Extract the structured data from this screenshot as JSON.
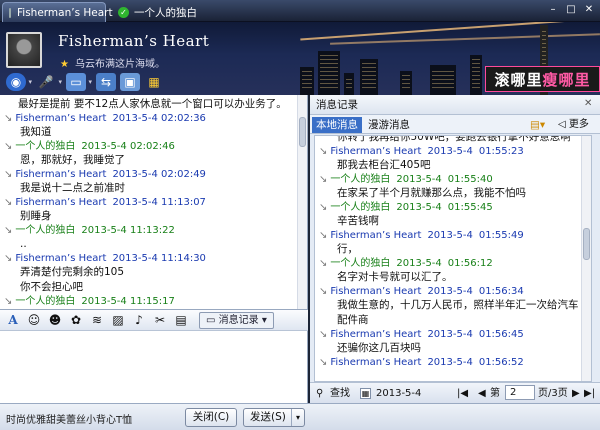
{
  "tabs": [
    {
      "label": "Fisherman’s Heart",
      "active": true
    },
    {
      "label": "一个人的独白",
      "active": false
    }
  ],
  "profile": {
    "name": "Fisherman’s Heart",
    "signature": "乌云布满这片海域。"
  },
  "banner": {
    "text_a": "滚哪里",
    "text_b": "瘦哪里"
  },
  "toolbar": {
    "icons": [
      "video-call-icon",
      "voice-call-icon",
      "file-transfer-icon",
      "remote-assist-icon",
      "screen-share-icon",
      "apps-grid-icon"
    ]
  },
  "chat": {
    "top_line": "最好是提前  要不12点人家休息就一个窗口可以办业务了。",
    "messages": [
      {
        "sender": "Fisherman’s Heart",
        "time": "2013-5-4 02:02:36",
        "side": "me",
        "lines": [
          "我知道"
        ]
      },
      {
        "sender": "一个人的独白",
        "time": "2013-5-4 02:02:46",
        "side": "other",
        "lines": [
          "恩，那就好，我睡觉了"
        ]
      },
      {
        "sender": "Fisherman’s Heart",
        "time": "2013-5-4 02:02:49",
        "side": "me",
        "lines": [
          "我是说十二点之前准时"
        ]
      },
      {
        "sender": "Fisherman’s Heart",
        "time": "2013-5-4 11:13:07",
        "side": "me",
        "lines": [
          "别睡身"
        ]
      },
      {
        "sender": "一个人的独白",
        "time": "2013-5-4 11:13:22",
        "side": "other",
        "lines": [
          ".."
        ]
      },
      {
        "sender": "Fisherman’s Heart",
        "time": "2013-5-4 11:14:30",
        "side": "me",
        "lines": [
          "弄清楚付完剩余的105",
          "你不会担心吧"
        ]
      },
      {
        "sender": "一个人的独白",
        "time": "2013-5-4 11:15:17",
        "side": "other",
        "lines": []
      }
    ]
  },
  "input_toolbar": {
    "history_button": "消息记录"
  },
  "bottom": {
    "ad_text": "时尚优雅甜美蕾丝小背心T恤",
    "close_label": "关闭(C)",
    "send_label": "发送(S)"
  },
  "history": {
    "title": "消息记录",
    "tab_local": "本地消息",
    "tab_roam": "漫游消息",
    "more_label": "更多",
    "messages": [
      {
        "sender": "",
        "time": "",
        "side": "me",
        "lines": [
          "你转了我再给你50W吧，要跑去银行拿不好意思啊"
        ]
      },
      {
        "sender": "Fisherman’s Heart",
        "time": "01:55:23",
        "side": "me",
        "lines": [
          "那我去柜台汇405吧"
        ]
      },
      {
        "sender": "一个人的独白",
        "time": "01:55:40",
        "side": "other",
        "lines": [
          "在家呆了半个月就赚那么点，我能不怕吗"
        ]
      },
      {
        "sender": "一个人的独白",
        "time": "01:55:45",
        "side": "other",
        "lines": [
          "辛苦钱啊"
        ]
      },
      {
        "sender": "Fisherman’s Heart",
        "time": "01:55:49",
        "side": "me",
        "lines": [
          "行，"
        ]
      },
      {
        "sender": "一个人的独白",
        "time": "01:56:12",
        "side": "other",
        "lines": [
          "名字对卡号就可以汇了。"
        ]
      },
      {
        "sender": "Fisherman’s Heart",
        "time": "01:56:34",
        "side": "me",
        "lines": [
          "我做生意的，十几万人民币，照样半年汇一次给汽车",
          "配件商"
        ]
      },
      {
        "sender": "Fisherman’s Heart",
        "time": "01:56:45",
        "side": "me",
        "lines": [
          "还骗你这几百块吗"
        ]
      },
      {
        "sender": "Fisherman’s Heart",
        "time": "01:56:52",
        "side": "me",
        "lines": []
      }
    ],
    "footer": {
      "search_label": "查找",
      "date": "2013-5-4",
      "page_prefix": "第",
      "page_current": "2",
      "page_suffix": "页/3页"
    }
  },
  "colors": {
    "me": "#1a3ab0",
    "other": "#188018",
    "accent": "#3a6fc7"
  }
}
